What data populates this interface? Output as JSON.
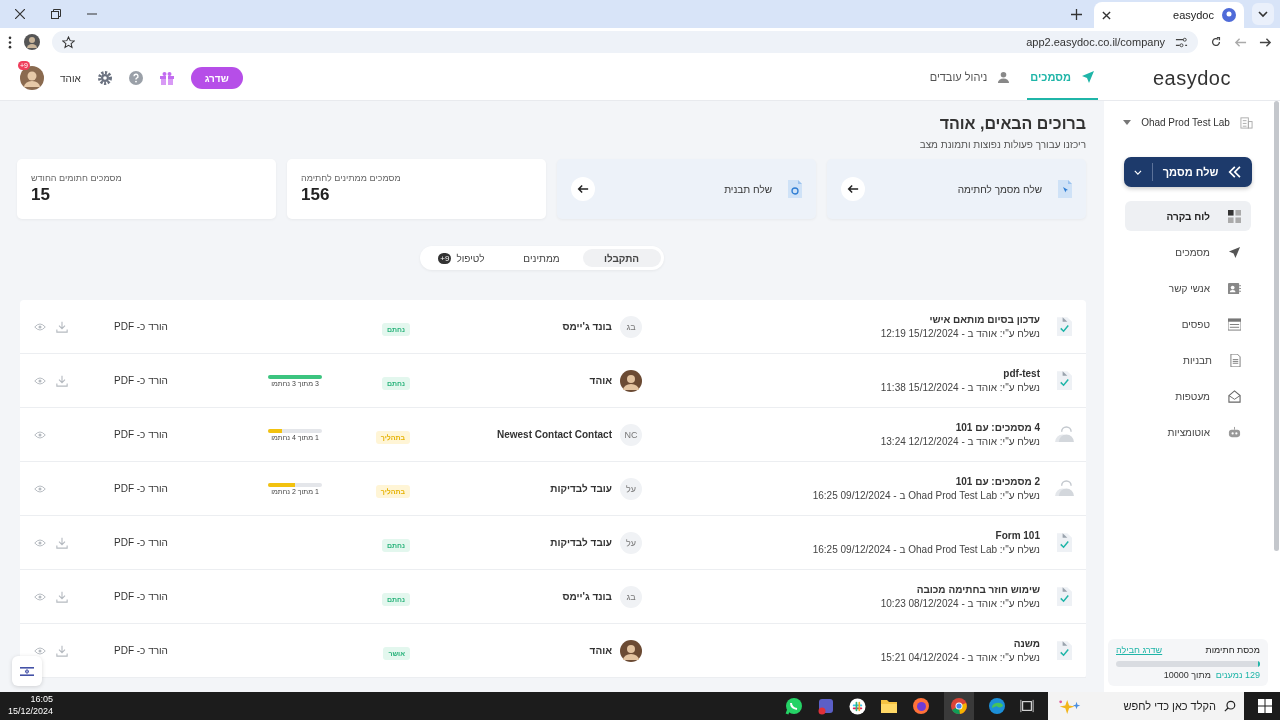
{
  "browser": {
    "tab_title": "easydoc",
    "url": "app2.easydoc.co.il/company"
  },
  "header": {
    "logo": "easydoc",
    "nav": [
      {
        "label": "מסמכים",
        "selected": true
      },
      {
        "label": "ניהול עובדים",
        "selected": false
      }
    ],
    "upgrade_button": "שדרג",
    "user_name": "אוהד",
    "notification_badge": "+9"
  },
  "sidebar": {
    "company": "Ohad Prod Test Lab",
    "send_button": "שלח מסמך",
    "items": [
      {
        "label": "לוח בקרה",
        "selected": true
      },
      {
        "label": "מסמכים",
        "selected": false
      },
      {
        "label": "אנשי קשר",
        "selected": false
      },
      {
        "label": "טפסים",
        "selected": false
      },
      {
        "label": "תבניות",
        "selected": false
      },
      {
        "label": "מעטפות",
        "selected": false
      },
      {
        "label": "אוטומציות",
        "selected": false
      }
    ],
    "quota": {
      "title": "מכסת חתימות",
      "link": "שדרג חבילה",
      "level": 0.013,
      "used": "129 נמענים",
      "total": "מתוך 10000"
    }
  },
  "welcome": {
    "title": "ברוכים הבאים, אוהד",
    "subtitle": "ריכזנו עבורך פעולות נפוצות ותמונת מצב"
  },
  "cards": [
    {
      "kind": "action",
      "label": "שלח מסמך לחתימה"
    },
    {
      "kind": "action",
      "label": "שלח תבנית"
    },
    {
      "kind": "stat",
      "label": "מסמכים ממתינים לחתימה",
      "value": "156"
    },
    {
      "kind": "stat",
      "label": "מסמכים חתומים החודש",
      "value": "15"
    }
  ],
  "filter_tabs": [
    {
      "label": "התקבלו",
      "selected": true
    },
    {
      "label": "ממתינים",
      "selected": false
    },
    {
      "label": "לטיפול",
      "selected": false,
      "badge": "+9"
    }
  ],
  "documents": [
    {
      "kind": "single",
      "title": "עדכון בסיום מותאם אישי",
      "sender": "נשלח ע\"י: אוהד ב - 15/12/2024 12:19",
      "contact": {
        "kind": "initials",
        "initials": "בג",
        "name": "בונד ג'יימס"
      },
      "status": {
        "kind": "signed",
        "label": "נחתם"
      },
      "pdf": "הורד כ- PDF",
      "downloadable": true
    },
    {
      "kind": "single",
      "title": "pdf-test",
      "sender": "נשלח ע\"י: אוהד ב - 15/12/2024 11:38",
      "contact": {
        "kind": "photo",
        "name": "אוהד"
      },
      "status": {
        "kind": "signed",
        "label": "נחתם"
      },
      "progress": {
        "level": 1,
        "text": "3 מתוך 3 נחתמו"
      },
      "pdf": "הורד כ- PDF",
      "downloadable": true
    },
    {
      "kind": "group",
      "title": "4 מסמכים: עם 101",
      "sender": "נשלח ע\"י: אוהד ב - 12/12/2024 13:24",
      "contact": {
        "kind": "initials",
        "initials": "NC",
        "name": "Newest Contact Contact"
      },
      "status": {
        "kind": "pending",
        "label": "בתהליך"
      },
      "progress": {
        "level": 0.25,
        "text": "1 מתוך 4 נחתמו"
      },
      "pdf": "הורד כ- PDF",
      "downloadable": false
    },
    {
      "kind": "group",
      "title": "2 מסמכים: עם 101",
      "sender": "נשלח ע\"י: Ohad Prod Test Lab ב - 09/12/2024 16:25",
      "contact": {
        "kind": "initials",
        "initials": "על",
        "name": "עובד לבדיקות"
      },
      "status": {
        "kind": "pending",
        "label": "בתהליך"
      },
      "progress": {
        "level": 0.5,
        "text": "1 מתוך 2 נחתמו"
      },
      "pdf": "הורד כ- PDF",
      "downloadable": false
    },
    {
      "kind": "single",
      "title": "Form 101",
      "sender": "נשלח ע\"י: Ohad Prod Test Lab ב - 09/12/2024 16:25",
      "contact": {
        "kind": "initials",
        "initials": "על",
        "name": "עובד לבדיקות"
      },
      "status": {
        "kind": "signed",
        "label": "נחתם"
      },
      "pdf": "הורד כ- PDF",
      "downloadable": true
    },
    {
      "kind": "single",
      "title": "שימוש חוזר בחתימה מכובה",
      "sender": "נשלח ע\"י: אוהד ב - 08/12/2024 10:23",
      "contact": {
        "kind": "initials",
        "initials": "בג",
        "name": "בונד ג'יימס"
      },
      "status": {
        "kind": "signed",
        "label": "נחתם"
      },
      "pdf": "הורד כ- PDF",
      "downloadable": true
    },
    {
      "kind": "single",
      "title": "משנה",
      "sender": "נשלח ע\"י: אוהד ב - 04/12/2024 15:21",
      "contact": {
        "kind": "photo",
        "name": "אוהד"
      },
      "status": {
        "kind": "approved",
        "label": "אושר"
      },
      "pdf": "הורד כ- PDF",
      "downloadable": true
    }
  ],
  "taskbar": {
    "search_placeholder": "הקלד כאן כדי לחפש",
    "time": "16:05",
    "date": "15/12/2024"
  }
}
